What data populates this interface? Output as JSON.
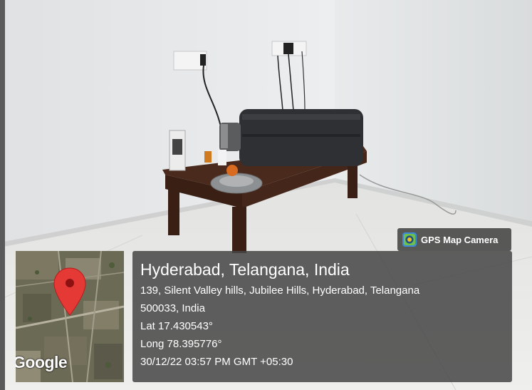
{
  "badge": {
    "label": "GPS Map Camera",
    "icon": "gps-map-camera-icon"
  },
  "map": {
    "brand": "Google",
    "pin_color": "#e53935",
    "icon": "location-pin-icon"
  },
  "location": {
    "title": "Hyderabad, Telangana, India",
    "address_line1": "139, Silent Valley hills, Jubilee Hills, Hyderabad, Telangana",
    "address_line2": "500033, India",
    "lat": "Lat 17.430543°",
    "long": "Long 78.395776°",
    "timestamp": "30/12/22 03:57 PM GMT +05:30"
  }
}
